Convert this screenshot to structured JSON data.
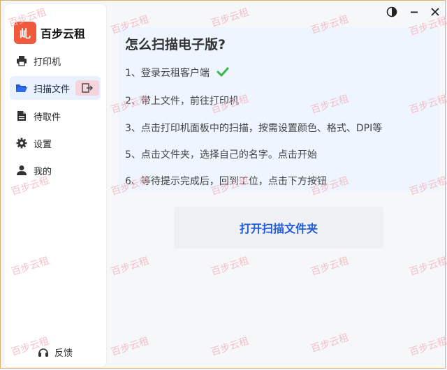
{
  "app": {
    "logo_glyph": "乢",
    "name": "百步云租"
  },
  "sidebar": {
    "items": [
      {
        "label": "打印机",
        "icon": "printer-icon"
      },
      {
        "label": "扫描文件",
        "icon": "folder-open-icon"
      },
      {
        "label": "待取件",
        "icon": "document-icon"
      },
      {
        "label": "设置",
        "icon": "gear-icon"
      },
      {
        "label": "我的",
        "icon": "user-icon"
      }
    ],
    "active_index": 1,
    "feedback_label": "反馈"
  },
  "main": {
    "title": "怎么扫描电子版?",
    "steps": [
      "1、登录云租客户端",
      "2、带上文件，前往打印机",
      "3、点击打印机面板中的扫描，按需设置颜色、格式、DPI等",
      "5、点击文件夹，选择自己的名字。点击开始",
      "6、等待提示完成后，回到工位，点击下方按钮"
    ],
    "open_button_label": "打开扫描文件夹"
  },
  "watermark_text": "百步云租",
  "colors": {
    "accent": "#1f5bd9",
    "logo_bg": "#ef5a3c",
    "active_bg": "#e8f1fd",
    "content_bg": "#eef5ff",
    "watermark": "#f2b7bf",
    "check_green": "#3bb54a"
  }
}
